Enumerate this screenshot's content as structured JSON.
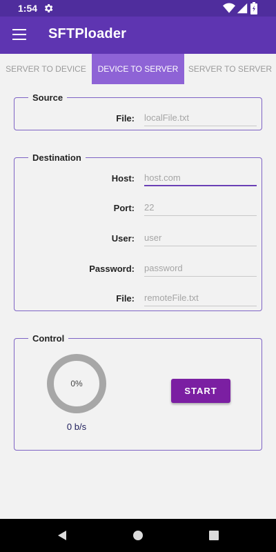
{
  "status_bar": {
    "time": "1:54",
    "icons": [
      "gear-icon",
      "wifi-icon",
      "signal-icon",
      "battery-icon"
    ]
  },
  "app_bar": {
    "title": "SFTPloader",
    "menu_icon": "hamburger-menu-icon"
  },
  "tabs": [
    {
      "label": "SERVER TO DEVICE",
      "active": false
    },
    {
      "label": "DEVICE TO SERVER",
      "active": true
    },
    {
      "label": "SERVER TO SERVER",
      "active": false
    }
  ],
  "source": {
    "legend": "Source",
    "file_label": "File:",
    "file_placeholder": "localFile.txt",
    "file_value": ""
  },
  "destination": {
    "legend": "Destination",
    "host_label": "Host:",
    "host_placeholder": "host.com",
    "port_label": "Port:",
    "port_placeholder": "22",
    "user_label": "User:",
    "user_placeholder": "user",
    "password_label": "Password:",
    "password_placeholder": "password",
    "file_label": "File:",
    "file_placeholder": "remoteFile.txt"
  },
  "control": {
    "legend": "Control",
    "progress_text": "0%",
    "progress_fraction": 0,
    "speed": "0 b/s",
    "start_label": "START"
  },
  "colors": {
    "status_bar": "#4f2d9d",
    "app_bar": "#5e35b1",
    "active_tab": "#8e63d6",
    "start_button": "#7b1fa2",
    "group_border": "#7d62c4"
  }
}
